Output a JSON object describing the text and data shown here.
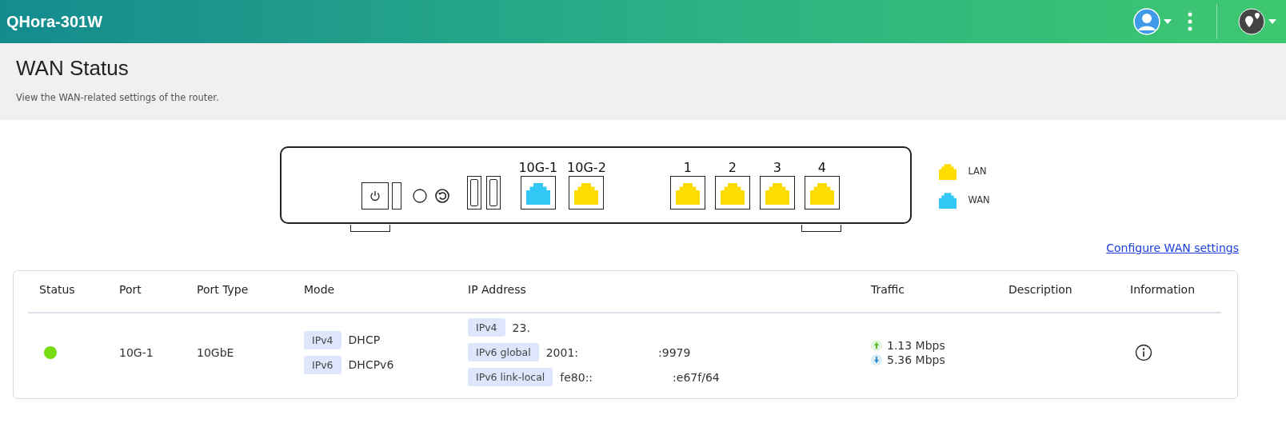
{
  "header": {
    "title": "QHora-301W"
  },
  "page": {
    "title": "WAN Status",
    "subtitle": "View the WAN-related settings of the router."
  },
  "router": {
    "ports": [
      {
        "label": "10G-1",
        "kind": "wan"
      },
      {
        "label": "10G-2",
        "kind": "lan"
      },
      {
        "label": "1",
        "kind": "lan"
      },
      {
        "label": "2",
        "kind": "lan"
      },
      {
        "label": "3",
        "kind": "lan"
      },
      {
        "label": "4",
        "kind": "lan"
      }
    ]
  },
  "legend": [
    {
      "label": "LAN",
      "kind": "lan"
    },
    {
      "label": "WAN",
      "kind": "wan"
    }
  ],
  "configure_link": "Configure WAN settings",
  "table": {
    "columns": [
      "Status",
      "Port",
      "Port Type",
      "Mode",
      "IP Address",
      "Traffic",
      "Description",
      "Information"
    ],
    "rows": [
      {
        "color": "#77dd11",
        "port": "10G-1",
        "port_type": "10GbE",
        "mode": [
          {
            "tag": "IPv4",
            "value": "DHCP"
          },
          {
            "tag": "IPv6",
            "value": "DHCPv6"
          }
        ],
        "ip": [
          {
            "tag": "IPv4",
            "parts": [
              "23."
            ]
          },
          {
            "tag": "IPv6 global",
            "parts": [
              "2001:",
              ":9979"
            ]
          },
          {
            "tag": "IPv6 link-local",
            "parts": [
              "fe80::",
              ":e67f/64"
            ]
          }
        ],
        "traffic": {
          "up": "1.13 Mbps",
          "down": "5.36 Mbps"
        }
      }
    ]
  }
}
